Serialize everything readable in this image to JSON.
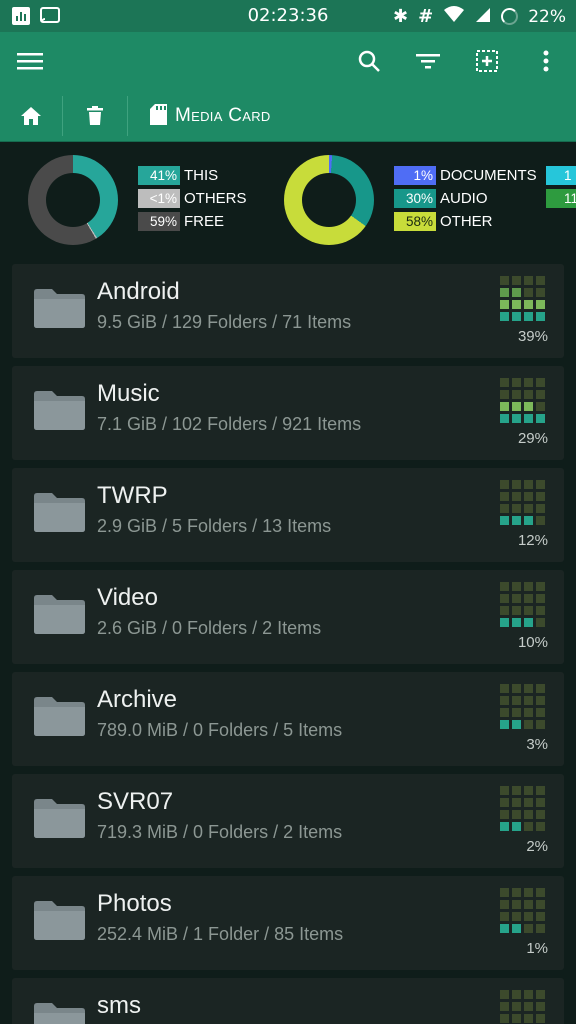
{
  "status_bar": {
    "time": "02:23:36",
    "battery": "22%",
    "icons": [
      "stats-icon",
      "cast-icon",
      "bluetooth-icon",
      "hash-icon",
      "wifi-icon",
      "signal-icon",
      "battery-icon"
    ]
  },
  "toolbar": {
    "icons": [
      "menu-icon",
      "search-icon",
      "filter-icon",
      "select-icon",
      "more-vert-icon"
    ]
  },
  "breadcrumb": {
    "label": "Media Card",
    "icons": [
      "home-icon",
      "trash-icon",
      "sd-card-icon"
    ]
  },
  "summary": {
    "chart_data": [
      {
        "type": "pie",
        "categories": [
          "THIS",
          "OTHERS",
          "FREE"
        ],
        "labels": [
          "41%",
          "<1%",
          "59%"
        ],
        "values": [
          41,
          0.5,
          58.5
        ],
        "colors": [
          "#26a69a",
          "#bdbdbd",
          "#4a4a4a"
        ]
      },
      {
        "type": "pie",
        "categories": [
          "DOCUMENTS",
          "AUDIO",
          "OTHER",
          "",
          ""
        ],
        "labels": [
          "1%",
          "30%",
          "58%",
          "1",
          "11"
        ],
        "values": [
          1,
          30,
          58,
          1,
          11
        ],
        "colors": [
          "#4f6df5",
          "#17978a",
          "#c8dc3a",
          "#26c6da",
          "#2e9b3f"
        ]
      }
    ]
  },
  "folders": [
    {
      "name": "Android",
      "info": "9.5 GiB / 129 Folders / 71 Items",
      "percent": "39%",
      "level": 39
    },
    {
      "name": "Music",
      "info": "7.1 GiB / 102 Folders / 921 Items",
      "percent": "29%",
      "level": 29
    },
    {
      "name": "TWRP",
      "info": "2.9 GiB / 5 Folders / 13 Items",
      "percent": "12%",
      "level": 12
    },
    {
      "name": "Video",
      "info": "2.6 GiB / 0 Folders / 2 Items",
      "percent": "10%",
      "level": 10
    },
    {
      "name": "Archive",
      "info": "789.0 MiB / 0 Folders / 5 Items",
      "percent": "3%",
      "level": 3
    },
    {
      "name": "SVR07",
      "info": "719.3 MiB / 0 Folders / 2 Items",
      "percent": "2%",
      "level": 2
    },
    {
      "name": "Photos",
      "info": "252.4 MiB / 1 Folder / 85 Items",
      "percent": "1%",
      "level": 1
    },
    {
      "name": "sms",
      "info": "",
      "percent": "",
      "level": 1
    }
  ],
  "colors": {
    "toolbar": "#1e8a65",
    "status_bar": "#1c7556",
    "background": "#0f1d1a",
    "card": "#1b2523"
  }
}
